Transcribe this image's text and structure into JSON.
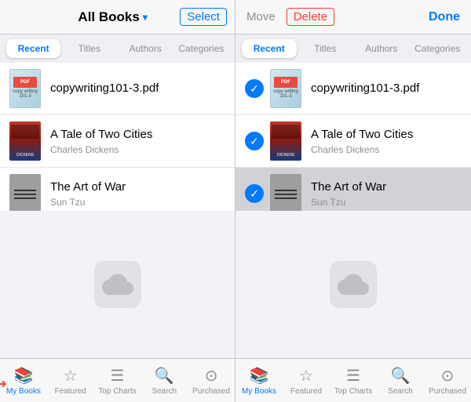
{
  "left_panel": {
    "header": {
      "title": "All Books",
      "dropdown_arrow": "▼",
      "select_btn": "Select"
    },
    "tabs": [
      {
        "label": "Recent",
        "active": true
      },
      {
        "label": "Titles",
        "active": false
      },
      {
        "label": "Authors",
        "active": false
      },
      {
        "label": "Categories",
        "active": false
      }
    ],
    "books": [
      {
        "id": "book1",
        "title": "copywriting101-3.pdf",
        "author": "",
        "cover_type": "pdf"
      },
      {
        "id": "book2",
        "title": "A Tale of Two Cities",
        "author": "Charles Dickens",
        "cover_type": "tale"
      },
      {
        "id": "book3",
        "title": "The Art of War",
        "author": "Sun Tzu",
        "cover_type": "war"
      }
    ],
    "bottom_tabs": [
      {
        "label": "My Books",
        "active": true,
        "icon": "books"
      },
      {
        "label": "Featured",
        "active": false,
        "icon": "star"
      },
      {
        "label": "Top Charts",
        "active": false,
        "icon": "list"
      },
      {
        "label": "Search",
        "active": false,
        "icon": "search"
      },
      {
        "label": "Purchased",
        "active": false,
        "icon": "circle"
      }
    ]
  },
  "right_panel": {
    "header": {
      "move_btn": "Move",
      "delete_btn": "Delete",
      "done_btn": "Done"
    },
    "tabs": [
      {
        "label": "Recent",
        "active": true
      },
      {
        "label": "Titles",
        "active": false
      },
      {
        "label": "Authors",
        "active": false
      },
      {
        "label": "Categories",
        "active": false
      }
    ],
    "books": [
      {
        "id": "rbook1",
        "title": "copywriting101-3.pdf",
        "author": "",
        "cover_type": "pdf",
        "selected": true
      },
      {
        "id": "rbook2",
        "title": "A Tale of Two Cities",
        "author": "Charles Dickens",
        "cover_type": "tale",
        "selected": true
      },
      {
        "id": "rbook3",
        "title": "The Art of War",
        "author": "Sun Tzu",
        "cover_type": "war",
        "selected": true,
        "highlight": true
      }
    ],
    "bottom_tabs": [
      {
        "label": "My Books",
        "active": true,
        "icon": "books"
      },
      {
        "label": "Featured",
        "active": false,
        "icon": "star"
      },
      {
        "label": "Top Charts",
        "active": false,
        "icon": "list"
      },
      {
        "label": "Search",
        "active": false,
        "icon": "search"
      },
      {
        "label": "Purchased",
        "active": false,
        "icon": "circle"
      }
    ]
  }
}
